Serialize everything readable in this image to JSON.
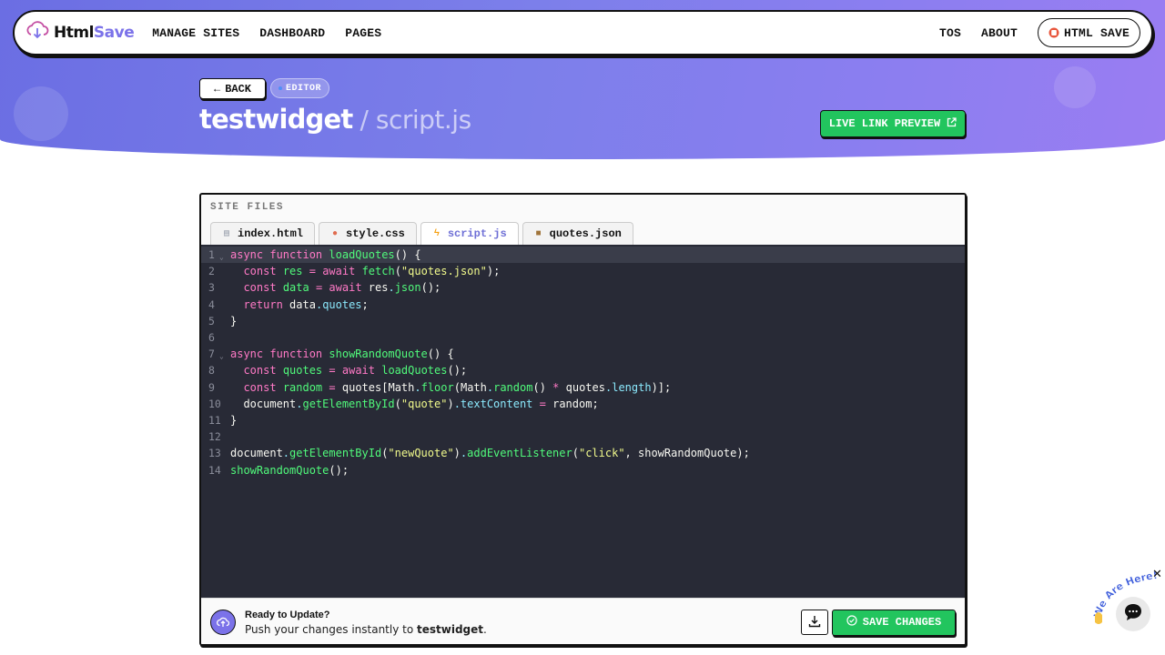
{
  "brand": {
    "part1": "Html",
    "part2": "Save"
  },
  "nav": {
    "left": [
      "MANAGE SITES",
      "DASHBOARD",
      "PAGES"
    ],
    "right": [
      "TOS",
      "ABOUT"
    ],
    "html_save_label": "HTML SAVE"
  },
  "header": {
    "back_label": "BACK",
    "badge_label": "EDITOR",
    "site_name": "testwidget",
    "separator": "/",
    "file_name": "script.js",
    "live_preview_label": "LIVE LINK PREVIEW"
  },
  "panel": {
    "files_label": "SITE FILES",
    "tabs": [
      {
        "label": "index.html",
        "icon": "html-file-icon"
      },
      {
        "label": "style.css",
        "icon": "palette-icon"
      },
      {
        "label": "script.js",
        "icon": "bolt-icon",
        "active": true
      },
      {
        "label": "quotes.json",
        "icon": "package-icon"
      }
    ]
  },
  "code": {
    "language": "javascript",
    "lines": [
      "async function loadQuotes() {",
      "  const res = await fetch(\"quotes.json\");",
      "  const data = await res.json();",
      "  return data.quotes;",
      "}",
      "",
      "async function showRandomQuote() {",
      "  const quotes = await loadQuotes();",
      "  const random = quotes[Math.floor(Math.random() * quotes.length)];",
      "  document.getElementById(\"quote\").textContent = random;",
      "}",
      "",
      "document.getElementById(\"newQuote\").addEventListener(\"click\", showRandomQuote);",
      "showRandomQuote();"
    ]
  },
  "footer": {
    "title": "Ready to Update?",
    "subtitle_prefix": "Push your changes instantly to ",
    "subtitle_site": "testwidget",
    "subtitle_suffix": ".",
    "save_label": "SAVE CHANGES"
  },
  "chat": {
    "badge_text": "We Are Here!"
  },
  "colors": {
    "accent": "#7b72e9",
    "success": "#22c55e",
    "code_bg": "#282a36"
  }
}
